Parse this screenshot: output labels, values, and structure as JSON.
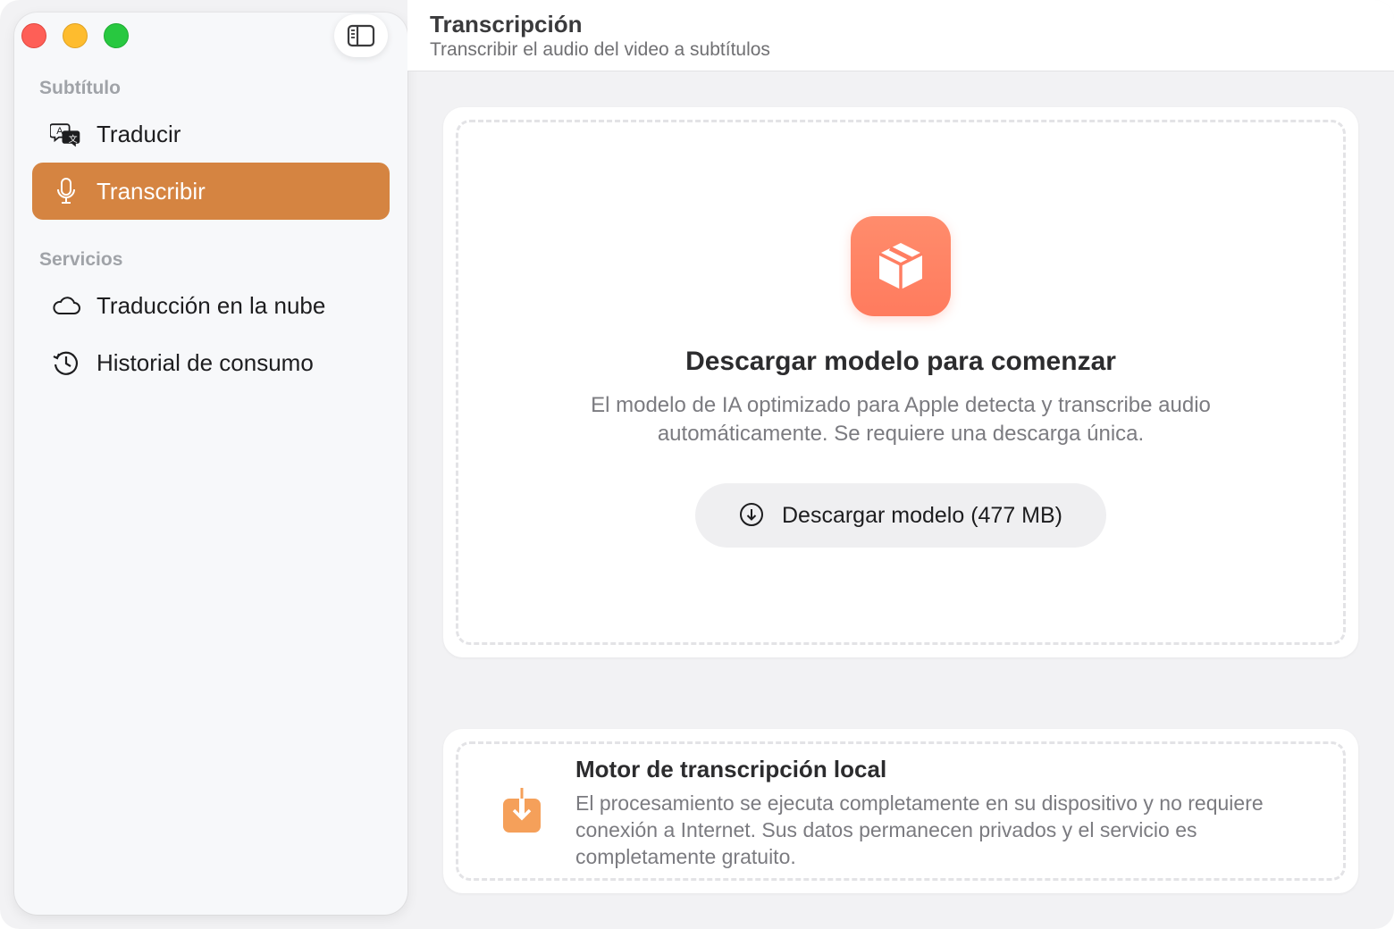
{
  "header": {
    "title": "Transcripción",
    "subtitle": "Transcribir el audio del video a subtítulos"
  },
  "sidebar": {
    "sections": [
      {
        "label": "Subtítulo",
        "items": [
          {
            "label": "Traducir",
            "icon": "translate-icon",
            "active": false
          },
          {
            "label": "Transcribir",
            "icon": "microphone-icon",
            "active": true
          }
        ]
      },
      {
        "label": "Servicios",
        "items": [
          {
            "label": "Traducción en la nube",
            "icon": "cloud-icon",
            "active": false
          },
          {
            "label": "Historial de consumo",
            "icon": "history-icon",
            "active": false
          }
        ]
      }
    ],
    "active_color": "#d58441"
  },
  "main": {
    "icon": "package-icon",
    "title": "Descargar modelo para comenzar",
    "description": "El modelo de IA optimizado para Apple detecta y transcribe audio automáticamente. Se requiere una descarga única.",
    "download_button": "Descargar modelo (477 MB)",
    "icon_color": "#ff7e62"
  },
  "info": {
    "icon": "download-tray-icon",
    "title": "Motor de transcripción local",
    "description": "El procesamiento se ejecuta completamente en su dispositivo y no requiere conexión a Internet. Sus datos permanecen privados y el servicio es completamente gratuito.",
    "icon_color": "#f5a05a"
  }
}
